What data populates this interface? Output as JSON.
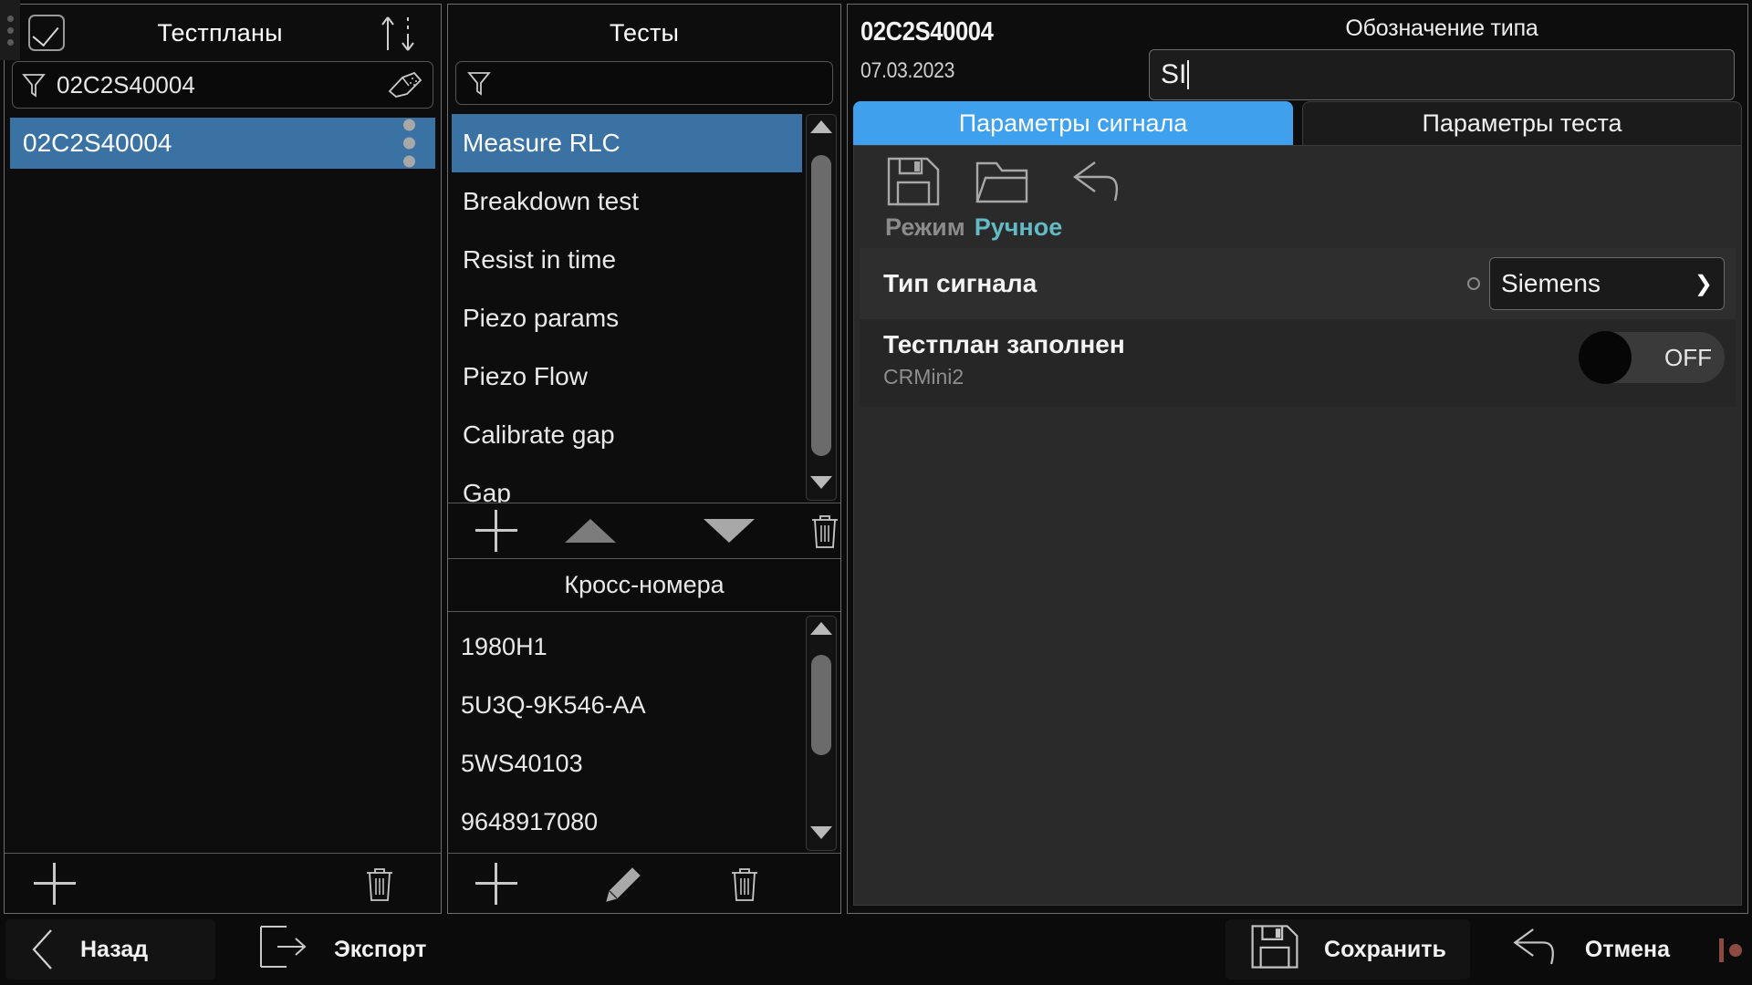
{
  "left": {
    "title": "Тестпланы",
    "checkbox_icon": "checkbox-checked-icon",
    "sort_icon": "sort-asc-desc-icon",
    "filter": {
      "icon": "funnel-icon",
      "value": "02C2S40004",
      "clear_icon": "eraser-icon"
    },
    "rows": [
      {
        "label": "02C2S40004",
        "selected": true,
        "menu_icon": "vertical-dots-icon"
      }
    ],
    "footer": {
      "add_icon": "plus-icon",
      "delete_icon": "trash-icon"
    }
  },
  "middle": {
    "title": "Тесты",
    "filter": {
      "icon": "funnel-icon",
      "value": ""
    },
    "tests": [
      {
        "label": "Measure RLC",
        "selected": true
      },
      {
        "label": "Breakdown test",
        "selected": false
      },
      {
        "label": "Resist in time",
        "selected": false
      },
      {
        "label": "Piezo params",
        "selected": false
      },
      {
        "label": "Calibrate gap",
        "selected": false
      },
      {
        "label": "Piezo Flow",
        "selected": false
      },
      {
        "label": "Gap",
        "selected": false
      }
    ],
    "tests_order": [
      "Measure RLC",
      "Breakdown test",
      "Resist in time",
      "Piezo params",
      "Piezo Flow",
      "Calibrate gap",
      "Gap"
    ],
    "tools": {
      "add_icon": "plus-icon",
      "move_up_icon": "triangle-up-icon",
      "move_down_icon": "triangle-down-icon",
      "delete_icon": "trash-icon"
    },
    "cross_title": "Кросс-номера",
    "cross_numbers": [
      "1980H1",
      "5U3Q-9K546-AA",
      "5WS40103",
      "9648917080"
    ],
    "cross_tools": {
      "add_icon": "plus-icon",
      "edit_icon": "pencil-icon",
      "delete_icon": "trash-icon"
    }
  },
  "right": {
    "id": "02C2S40004",
    "date": "07.03.2023",
    "type_caption": "Обозначение типа",
    "type_value": "SI",
    "tabs": [
      {
        "label": "Параметры сигнала",
        "active": true
      },
      {
        "label": "Параметры теста",
        "active": false
      }
    ],
    "toolbar": {
      "save_icon": "floppy-disk-icon",
      "open_icon": "folder-open-icon",
      "undo_icon": "undo-arrow-icon",
      "mode_label": "Режим",
      "mode_value": "Ручное"
    },
    "params": [
      {
        "label": "Тип сигнала",
        "sub": "",
        "control": "combo",
        "value": "Siemens",
        "radio_icon": "radio-circle-icon",
        "chevron_icon": "chevron-down-icon"
      },
      {
        "label": "Тестплан заполнен",
        "sub": "CRMini2",
        "control": "toggle",
        "value": "OFF"
      }
    ]
  },
  "bottom": {
    "back": {
      "label": "Назад",
      "icon": "chevron-left-icon"
    },
    "export": {
      "label": "Экспорт",
      "icon": "export-arrow-icon"
    },
    "save": {
      "label": "Сохранить",
      "icon": "floppy-disk-icon"
    },
    "cancel": {
      "label": "Отмена",
      "icon": "undo-arrow-icon"
    },
    "status_icon": "record-indicator-icon"
  },
  "colors": {
    "accent_blue": "#3fa0ee",
    "selection_blue": "#3a72a4",
    "mode_teal": "#63b9c4",
    "panel_bg": "#0d0d0d"
  }
}
